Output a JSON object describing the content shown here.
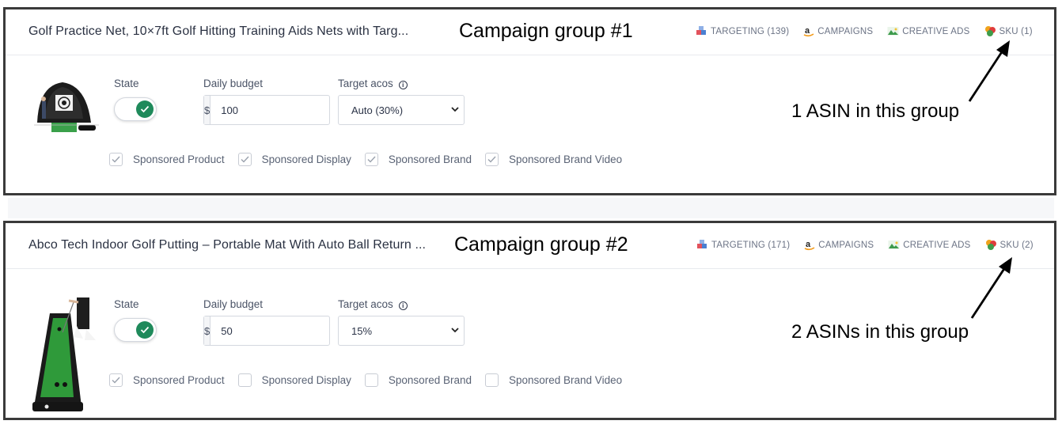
{
  "groups": [
    {
      "product_title": "Golf Practice Net, 10×7ft Golf Hitting Training Aids Nets with Targ...",
      "annotation": "Campaign group #1",
      "links": {
        "targeting": "TARGETING (139)",
        "campaigns": "CAMPAIGNS",
        "creative_ads": "CREATIVE ADS",
        "sku": "SKU (1)"
      },
      "state_label": "State",
      "state_on": true,
      "budget_label": "Daily budget",
      "currency": "$",
      "budget_value": "100",
      "acos_label": "Target acos",
      "acos_value": "Auto (30%)",
      "ad_types": [
        {
          "label": "Sponsored Product",
          "checked": true
        },
        {
          "label": "Sponsored Display",
          "checked": true
        },
        {
          "label": "Sponsored Brand",
          "checked": true
        },
        {
          "label": "Sponsored Brand Video",
          "checked": true
        }
      ],
      "note": "1 ASIN in this group"
    },
    {
      "product_title": "Abco Tech Indoor Golf Putting – Portable Mat With Auto Ball Return ...",
      "annotation": "Campaign group #2",
      "links": {
        "targeting": "TARGETING (171)",
        "campaigns": "CAMPAIGNS",
        "creative_ads": "CREATIVE ADS",
        "sku": "SKU (2)"
      },
      "state_label": "State",
      "state_on": true,
      "budget_label": "Daily budget",
      "currency": "$",
      "budget_value": "50",
      "acos_label": "Target acos",
      "acos_value": "15%",
      "ad_types": [
        {
          "label": "Sponsored Product",
          "checked": true
        },
        {
          "label": "Sponsored Display",
          "checked": false
        },
        {
          "label": "Sponsored Brand",
          "checked": false
        },
        {
          "label": "Sponsored Brand Video",
          "checked": false
        }
      ],
      "note": "2 ASINs in this group"
    }
  ],
  "colors": {
    "toggle_on": "#1f8a5b",
    "checkmark": "#9aa1ad",
    "border_dark": "#3a3a3a"
  }
}
